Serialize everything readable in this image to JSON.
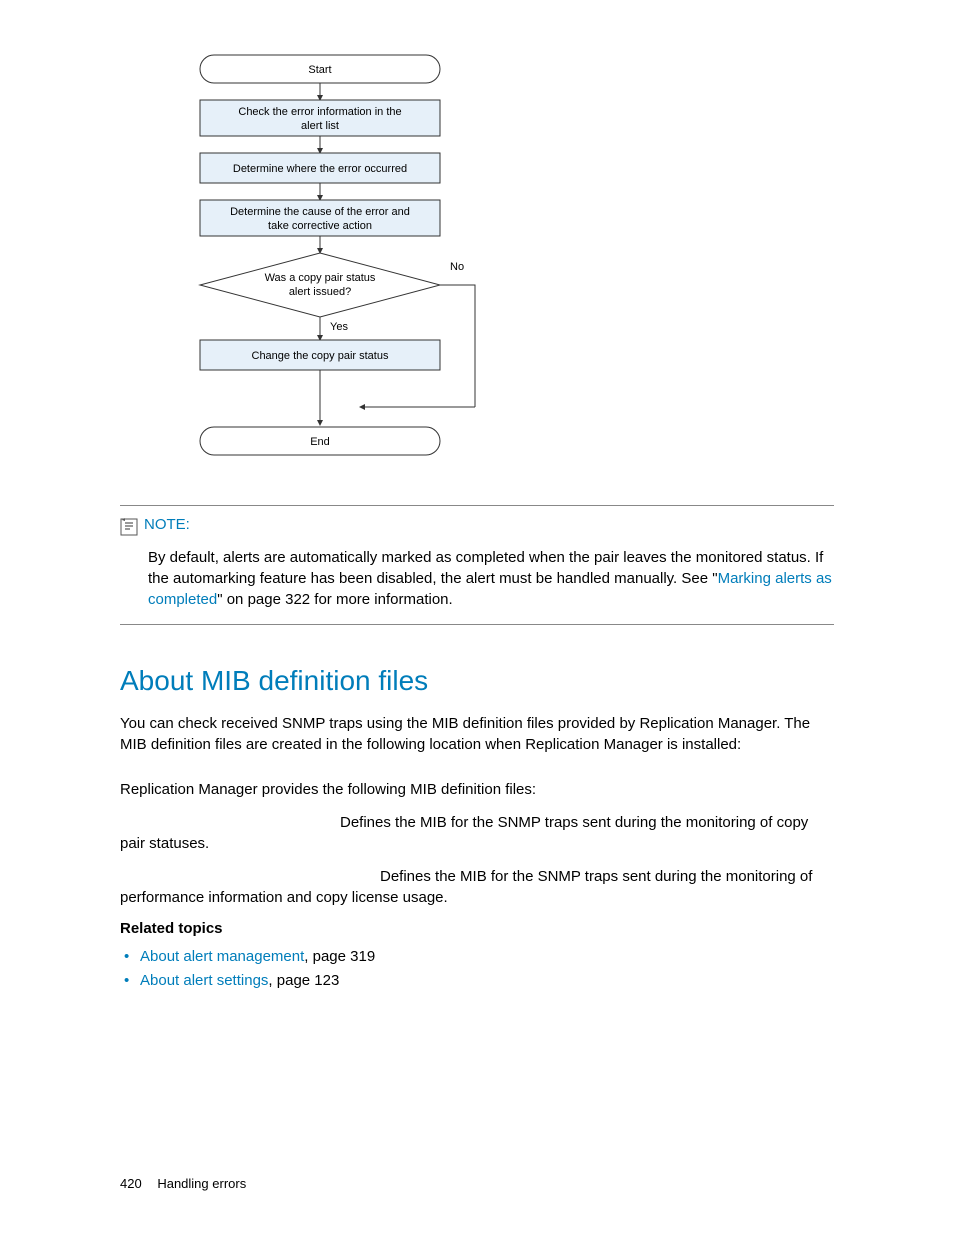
{
  "flowchart": {
    "start": "Start",
    "step1a": "Check the error information in the",
    "step1b": "alert list",
    "step2": "Determine where the error occurred",
    "step3a": "Determine the cause of the error and",
    "step3b": "take corrective action",
    "decision_a": "Was a copy pair status",
    "decision_b": "alert issued?",
    "yes": "Yes",
    "no": "No",
    "step4": "Change the copy pair status",
    "end": "End"
  },
  "note": {
    "label": "NOTE:",
    "text_before": "By default, alerts are automatically marked as completed when the pair leaves the monitored status. If the automarking feature has been disabled, the alert must be handled manually. See \"",
    "link_text": "Marking alerts as completed",
    "text_after": "\" on page 322 for more information."
  },
  "section": {
    "heading": "About MIB definition files",
    "p1": "You can check received SNMP traps using the MIB definition files provided by Replication Manager. The MIB definition files are created in the following location when Replication Manager is installed:",
    "p2": "Replication Manager provides the following MIB definition files:",
    "p3_a": "Defines the MIB for the SNMP traps sent during the monitoring of copy pair statuses.",
    "p3_b": "Defines the MIB for the SNMP traps sent during the monitoring of performance information and copy license usage."
  },
  "related": {
    "heading": "Related topics",
    "items": [
      {
        "link": "About alert management",
        "tail": ", page 319"
      },
      {
        "link": "About alert settings",
        "tail": ", page 123"
      }
    ]
  },
  "footer": {
    "page_number": "420",
    "chapter": "Handling errors"
  }
}
